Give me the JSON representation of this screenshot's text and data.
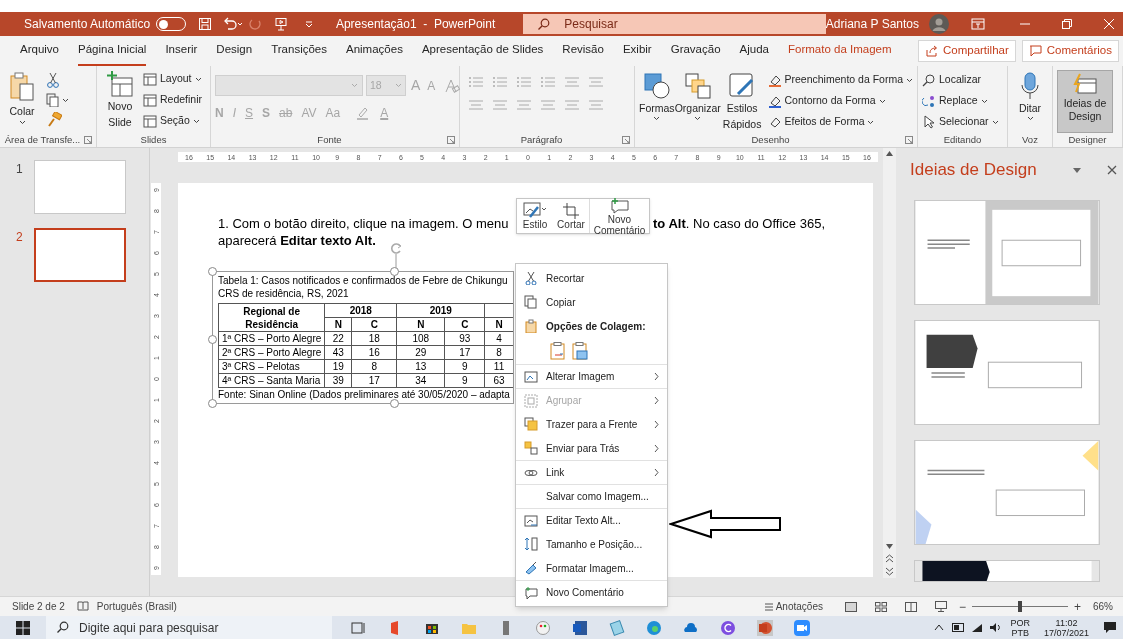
{
  "title_bar": {
    "autosave_label": "Salvamento Automático",
    "autosave_on": false,
    "document_title": "Apresentação1  -  PowerPoint",
    "search_placeholder": "Pesquisar",
    "user_name": "Adriana P Santos"
  },
  "ribbon_tabs": [
    {
      "label": "Arquivo",
      "selected": false,
      "kind": "normal"
    },
    {
      "label": "Página Inicial",
      "selected": true,
      "kind": "normal"
    },
    {
      "label": "Inserir",
      "selected": false,
      "kind": "normal"
    },
    {
      "label": "Design",
      "selected": false,
      "kind": "normal"
    },
    {
      "label": "Transições",
      "selected": false,
      "kind": "normal"
    },
    {
      "label": "Animações",
      "selected": false,
      "kind": "normal"
    },
    {
      "label": "Apresentação de Slides",
      "selected": false,
      "kind": "normal"
    },
    {
      "label": "Revisão",
      "selected": false,
      "kind": "normal"
    },
    {
      "label": "Exibir",
      "selected": false,
      "kind": "normal"
    },
    {
      "label": "Gravação",
      "selected": false,
      "kind": "normal"
    },
    {
      "label": "Ajuda",
      "selected": false,
      "kind": "normal"
    },
    {
      "label": "Formato da Imagem",
      "selected": false,
      "kind": "contextual"
    }
  ],
  "ribbon_actions": [
    "Compartilhar",
    "Comentários"
  ],
  "ribbon": {
    "clipboard": {
      "label": "Área de Transfe...",
      "paste": "Colar"
    },
    "slides": {
      "label": "Slides",
      "new_slide": "Novo Slide",
      "layout": "Layout",
      "reset": "Redefinir",
      "section": "Seção"
    },
    "font": {
      "label": "Fonte",
      "disabled": true,
      "font_size": "18",
      "grow": "A",
      "shrink": "A",
      "format_buttons": [
        "N",
        "I",
        "S",
        "S",
        "ab",
        "AV",
        "Aa"
      ],
      "font_color": "A"
    },
    "paragraph": {
      "label": "Parágrafo",
      "disabled": true
    },
    "drawing": {
      "label": "Desenho",
      "shapes": "Formas",
      "arrange": "Organizar",
      "quick_styles": "Estilos Rápidos",
      "fill": "Preenchimento da Forma",
      "outline": "Contorno da Forma",
      "effects": "Efeitos de Forma"
    },
    "editing": {
      "label": "Editando",
      "find": "Localizar",
      "replace": "Replace",
      "select": "Selecionar"
    },
    "voice": {
      "label": "Voz",
      "dictate": "Ditar"
    },
    "designer": {
      "label": "Designer",
      "design_ideas": "Ideias de Design",
      "selected": true
    }
  },
  "slide_thumbnails": [
    {
      "number": "1",
      "selected": false
    },
    {
      "number": "2",
      "selected": true
    }
  ],
  "rulers": {
    "horizontal": [
      "16",
      "15",
      "14",
      "13",
      "12",
      "11",
      "10",
      "9",
      "8",
      "7",
      "6",
      "5",
      "4",
      "3",
      "2",
      "1",
      "0",
      "1",
      "2",
      "3",
      "4",
      "5",
      "6",
      "7",
      "8",
      "9",
      "10",
      "11",
      "12",
      "13",
      "14",
      "15",
      "16"
    ],
    "vertical": [
      "9",
      "8",
      "7",
      "6",
      "5",
      "4",
      "3",
      "2",
      "1",
      "0",
      "1",
      "2",
      "3",
      "4",
      "5",
      "6",
      "7",
      "8",
      "9"
    ]
  },
  "slide": {
    "instruction_left": "1. Com o botão direito, clique na imagem. O menu",
    "instruction_right": "**to Alt**. No caso do Office 365,",
    "instruction_line2": "aparecerá **Editar texto Alt.**",
    "table_caption": [
      "Tabela 1: Casos notificados e confirmados de Febre de Chikungu",
      "CRS de residência, RS, 2021"
    ],
    "table": {
      "region_header": "Regional de Residência",
      "years": [
        "2018",
        "2019"
      ],
      "sub_headers": [
        "N",
        "C",
        "N",
        "C",
        "N"
      ],
      "rows": [
        {
          "region": "1ª CRS – Porto Alegre",
          "values": [
            "22",
            "18",
            "108",
            "93",
            "4"
          ]
        },
        {
          "region": "2ª CRS – Porto Alegre",
          "values": [
            "43",
            "16",
            "29",
            "17",
            "8"
          ]
        },
        {
          "region": "3ª CRS – Pelotas",
          "values": [
            "19",
            "8",
            "13",
            "9",
            "11"
          ]
        },
        {
          "region": "4ª CRS – Santa Maria",
          "values": [
            "39",
            "17",
            "34",
            "9",
            "63"
          ]
        }
      ]
    },
    "table_source": "Fonte: Sinan Online (Dados preliminares até 30/05/2020 – adapta"
  },
  "mini_toolbar": [
    {
      "label": "Estilo"
    },
    {
      "label": "Cortar"
    },
    {
      "label": "Novo Comentário"
    }
  ],
  "context_menu": [
    {
      "kind": "item",
      "label": "Recortar",
      "submenu": false,
      "disabled": false,
      "divider_above": false
    },
    {
      "kind": "item",
      "label": "Copiar",
      "submenu": false,
      "disabled": false,
      "divider_above": false
    },
    {
      "kind": "header",
      "label": "Opções de Colagem:",
      "submenu": false,
      "disabled": false,
      "divider_above": false
    },
    {
      "kind": "paste_options"
    },
    {
      "kind": "item",
      "label": "Alterar Imagem",
      "submenu": true,
      "disabled": false,
      "divider_above": true
    },
    {
      "kind": "item",
      "label": "Agrupar",
      "submenu": true,
      "disabled": true,
      "divider_above": true
    },
    {
      "kind": "item",
      "label": "Trazer para a Frente",
      "submenu": true,
      "disabled": false,
      "divider_above": false
    },
    {
      "kind": "item",
      "label": "Enviar para Trás",
      "submenu": true,
      "disabled": false,
      "divider_above": false
    },
    {
      "kind": "item",
      "label": "Link",
      "submenu": true,
      "disabled": false,
      "divider_above": true
    },
    {
      "kind": "item",
      "label": "Salvar como Imagem...",
      "submenu": false,
      "disabled": false,
      "divider_above": true
    },
    {
      "kind": "item",
      "label": "Editar Texto Alt...",
      "submenu": false,
      "disabled": false,
      "divider_above": true
    },
    {
      "kind": "item",
      "label": "Tamanho e Posição...",
      "submenu": false,
      "disabled": false,
      "divider_above": false
    },
    {
      "kind": "item",
      "label": "Formatar Imagem...",
      "submenu": false,
      "disabled": false,
      "divider_above": false
    },
    {
      "kind": "item",
      "label": "Novo Comentário",
      "submenu": false,
      "disabled": false,
      "divider_above": true
    }
  ],
  "design_panel": {
    "title": "Ideias de Design",
    "designs": [
      {
        "kind": "split"
      },
      {
        "kind": "arrow"
      },
      {
        "kind": "corner"
      },
      {
        "kind": "banner"
      }
    ]
  },
  "status_bar": {
    "slide_indicator": "Slide 2 de 2",
    "language": "Português (Brasil)",
    "notes": "Anotações",
    "zoom_out": "−",
    "zoom_slider": {
      "level": 0.5
    },
    "zoom_in": "+",
    "zoom": "66%"
  },
  "taskbar": {
    "search_placeholder": "Digite aqui para pesquisar",
    "language": [
      "POR",
      "PTB"
    ],
    "time": "11:02",
    "date": "17/07/2021"
  }
}
